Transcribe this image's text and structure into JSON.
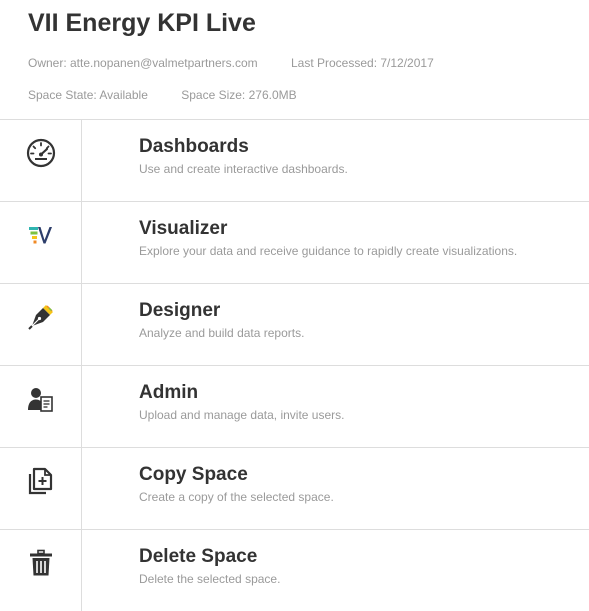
{
  "space": {
    "title": "VII Energy KPI Live",
    "owner": "Owner: atte.nopanen@valmetpartners.com",
    "last_processed": "Last Processed: 7/12/2017",
    "state": "Space State: Available",
    "size": "Space Size: 276.0MB"
  },
  "menu": [
    {
      "icon": "speedometer-icon",
      "name": "Dashboards",
      "desc": "Use and create interactive dashboards."
    },
    {
      "icon": "visualizer-logo-icon",
      "name": "Visualizer",
      "desc": "Explore your data and receive guidance to rapidly create visualizations."
    },
    {
      "icon": "pen-nib-icon",
      "name": "Designer",
      "desc": "Analyze and build data reports."
    },
    {
      "icon": "user-document-icon",
      "name": "Admin",
      "desc": "Upload and manage data, invite users."
    },
    {
      "icon": "copy-add-icon",
      "name": "Copy Space",
      "desc": "Create a copy of the selected space."
    },
    {
      "icon": "trash-icon",
      "name": "Delete Space",
      "desc": "Delete the selected space."
    }
  ],
  "colors": {
    "text_dark": "#333333",
    "text_muted": "#9a9a9a",
    "divider": "#dddddd",
    "accent_yellow": "#f5c518",
    "accent_orange": "#f08a24",
    "accent_green": "#7cc242",
    "accent_teal": "#2fb5b0",
    "accent_navy": "#2d3e6b"
  }
}
